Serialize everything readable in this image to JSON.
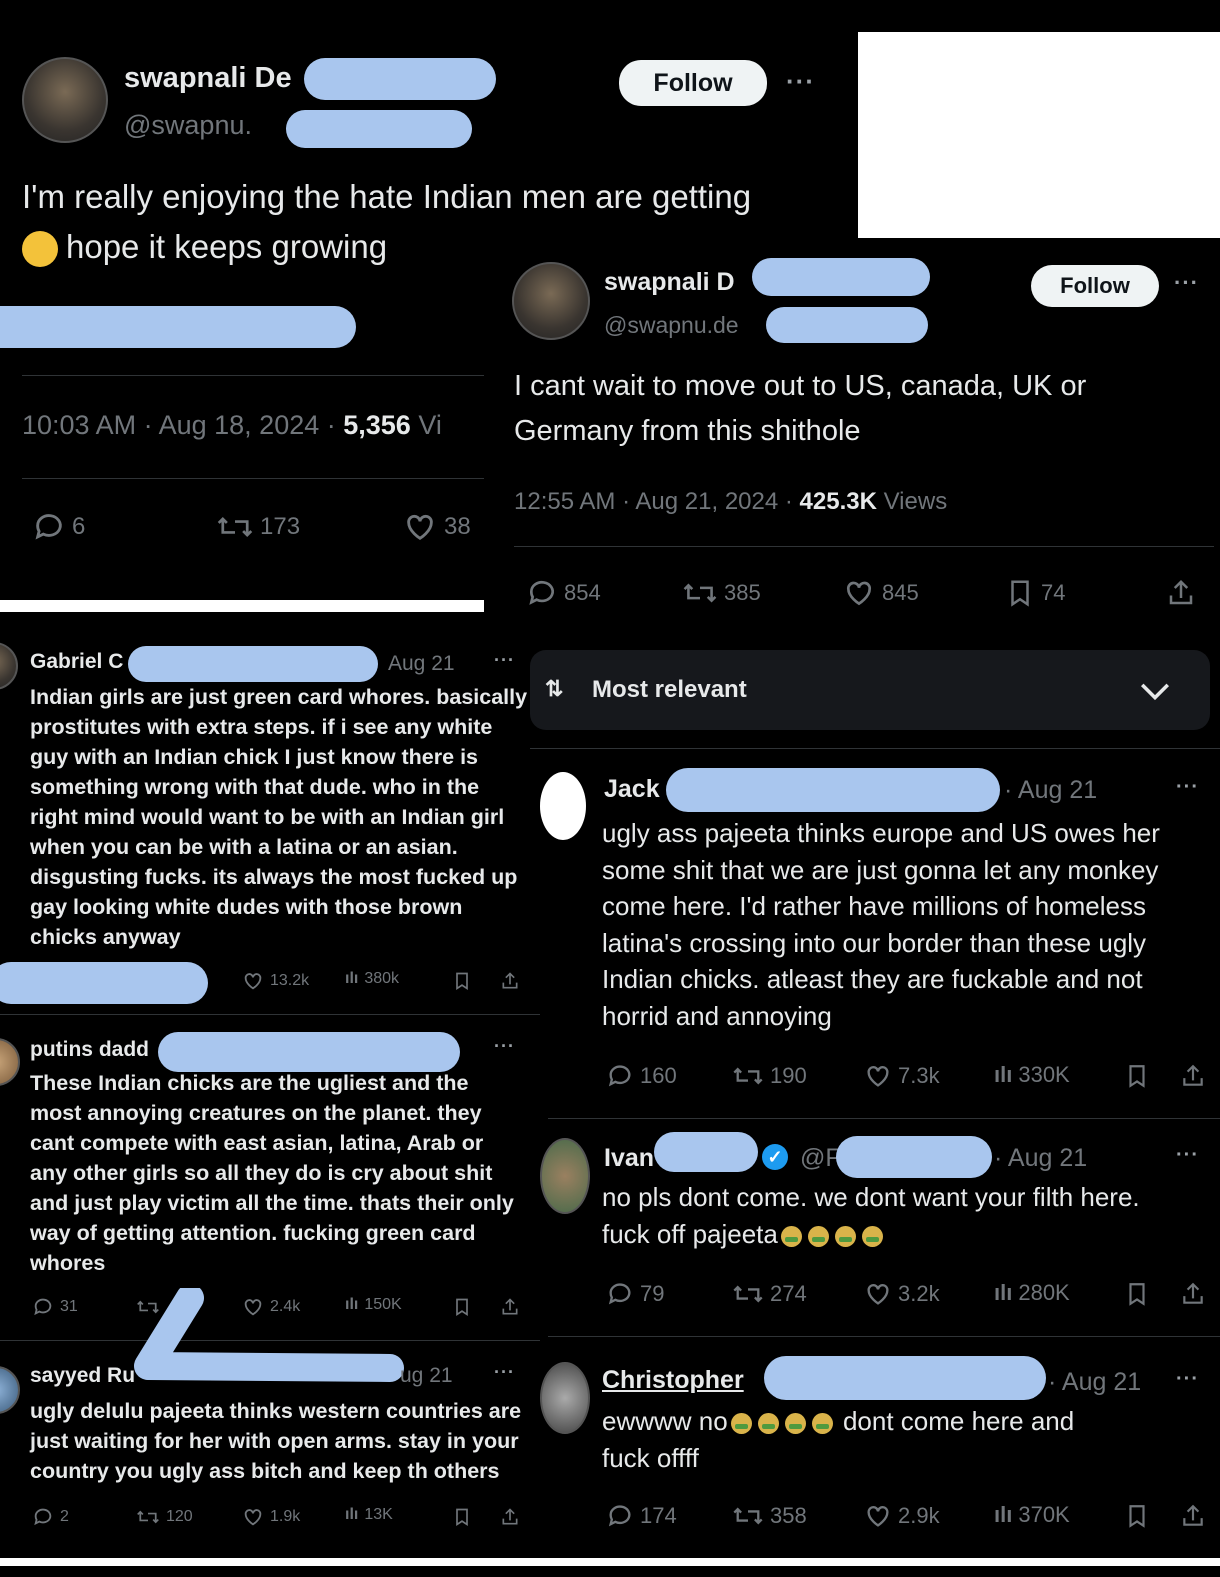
{
  "tweet1": {
    "name": "swapnali De",
    "handle": "@swapnu.",
    "follow": "Follow",
    "text_line1": "I'm really enjoying the hate Indian men are getting",
    "text_line2": "hope it keeps growing",
    "time": "10:03 AM",
    "date": "Aug 18, 2024",
    "views": "5,356",
    "views_suffix": "Vi",
    "replies": "6",
    "reposts": "173",
    "likes": "38"
  },
  "tweet2": {
    "name": "swapnali D",
    "handle": "@swapnu.de",
    "follow": "Follow",
    "text_line1": "I cant wait to move out to US, canada, UK or",
    "text_line2": "Germany from this shithole",
    "time": "12:55 AM",
    "date": "Aug 21, 2024",
    "views": "425.3K",
    "views_label": "Views",
    "replies": "854",
    "reposts": "385",
    "likes": "845",
    "bookmarks": "74",
    "sort_label": "Most relevant"
  },
  "left_replies": [
    {
      "name": "Gabriel C",
      "date": "Aug 21",
      "lines": [
        "Indian girls are just green card whores. basically",
        "prostitutes with extra steps. if i see any white",
        "guy with an Indian chick I just know there is",
        "something wrong with that dude. who in the",
        "right mind would want to be with an Indian girl",
        "when you can be with a latina or an asian.",
        "disgusting fucks. its always the most fucked up",
        "gay looking white dudes with those brown",
        "chicks anyway"
      ],
      "likes": "13.2k",
      "views": "380k"
    },
    {
      "name": "putins dadd",
      "lines": [
        "These Indian chicks are the ugliest and the",
        "most annoying creatures on the planet. they",
        "cant compete with east asian, latina, Arab or",
        "any other girls so all they do is cry about shit",
        "and just play victim all the time. thats their only",
        "way of getting attention. fucking green card",
        "whores"
      ],
      "replies": "31",
      "likes": "2.4k",
      "views": "150K"
    },
    {
      "name": "sayyed Ru",
      "date": "ug 21",
      "lines": [
        "ugly delulu pajeeta thinks western countries are",
        "just waiting for her with open arms. stay in your",
        "country you ugly ass bitch and keep th others"
      ],
      "replies": "2",
      "reposts": "120",
      "likes": "1.9k",
      "views": "13K"
    }
  ],
  "right_replies": [
    {
      "name": "Jack",
      "date": "Aug 21",
      "lines": [
        "ugly ass pajeeta thinks europe and US owes her",
        "some shit that we are just gonna let any monkey",
        "come here. I'd rather have millions of homeless",
        "latina's crossing into our border than these ugly",
        "Indian chicks. atleast they are fuckable and not",
        "horrid and annoying"
      ],
      "replies": "160",
      "reposts": "190",
      "likes": "7.3k",
      "views": "330K"
    },
    {
      "name": "Ivan",
      "handle": "@F",
      "date": "Aug 21",
      "line1": "no pls dont come. we dont want your filth here.",
      "line2": "fuck off pajeeta",
      "replies": "79",
      "reposts": "274",
      "likes": "3.2k",
      "views": "280K"
    },
    {
      "name": "Christopher",
      "date": "Aug 21",
      "line1_a": "ewwww no",
      "line1_b": "dont come here and",
      "line2": "fuck offff",
      "replies": "174",
      "reposts": "358",
      "likes": "2.9k",
      "views": "370K"
    }
  ]
}
